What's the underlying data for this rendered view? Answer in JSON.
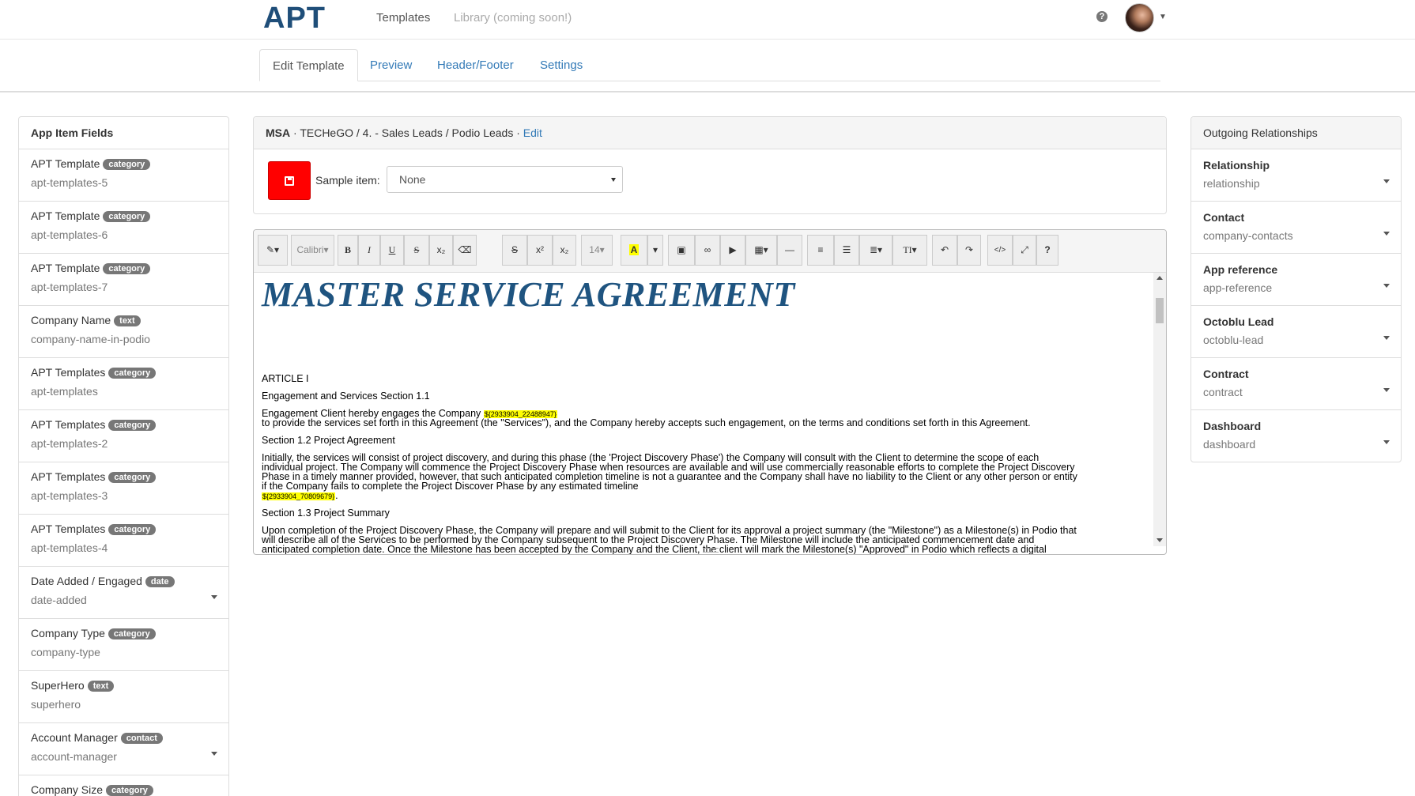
{
  "nav": {
    "logo": "APT",
    "templates": "Templates",
    "library": "Library (coming soon!)",
    "help_glyph": "?"
  },
  "tabs": [
    {
      "label": "Edit Template"
    },
    {
      "label": "Preview"
    },
    {
      "label": "Header/Footer"
    },
    {
      "label": "Settings"
    }
  ],
  "left_panel": {
    "title": "App Item Fields",
    "fields": [
      {
        "label": "APT Template",
        "type": "category",
        "slug": "apt-templates-5"
      },
      {
        "label": "APT Template",
        "type": "category",
        "slug": "apt-templates-6"
      },
      {
        "label": "APT Template",
        "type": "category",
        "slug": "apt-templates-7"
      },
      {
        "label": "Company Name",
        "type": "text",
        "slug": "company-name-in-podio"
      },
      {
        "label": "APT Templates",
        "type": "category",
        "slug": "apt-templates"
      },
      {
        "label": "APT Templates",
        "type": "category",
        "slug": "apt-templates-2"
      },
      {
        "label": "APT Templates",
        "type": "category",
        "slug": "apt-templates-3"
      },
      {
        "label": "APT Templates",
        "type": "category",
        "slug": "apt-templates-4"
      },
      {
        "label": "Date Added / Engaged",
        "type": "date",
        "slug": "date-added"
      },
      {
        "label": "Company Type",
        "type": "category",
        "slug": "company-type"
      },
      {
        "label": "SuperHero",
        "type": "text",
        "slug": "superhero"
      },
      {
        "label": "Account Manager",
        "type": "contact",
        "slug": "account-manager"
      },
      {
        "label": "Company Size",
        "type": "category",
        "slug": ""
      }
    ]
  },
  "center": {
    "crumb_bold": "MSA",
    "crumb_rest": " · TECHeGO / 4. - Sales Leads / Podio Leads · ",
    "crumb_edit": "Edit",
    "sample_label": "Sample item:",
    "sample_value": "None"
  },
  "toolbar": {
    "font": "Calibri",
    "size": "14",
    "bold": "B",
    "italic": "I",
    "underline": "U",
    "strike": "S",
    "sub": "x₂",
    "sup": "x²",
    "highlight": "A",
    "text_style": "TI"
  },
  "document": {
    "title": "MASTER SERVICE AGREEMENT",
    "article": "ARTICLE I",
    "section_1_1": "Engagement and Services Section 1.1",
    "engagement_pre": "Engagement Client hereby engages the Company ",
    "placeholder_1": "${2933904_22488947}",
    "engagement_line2": "to provide the services set forth in this Agreement (the \"Services\"), and the Company hereby accepts such engagement, on the terms and conditions set forth in this Agreement.",
    "section_1_2": "Section 1.2 Project Agreement",
    "p2_l1": "Initially, the services will consist of project discovery, and during this phase (the 'Project Discovery Phase') the Company will consult with the Client to determine the scope of each",
    "p2_l2": "individual project. The Company will commence the Project Discovery Phase when resources are available and will use commercially reasonable efforts to complete the Project Discovery",
    "p2_l3": "Phase in a timely manner provided, however, that such anticipated completion timeline is not a guarantee and the Company shall have no liability to the Client or any other person or entity",
    "p2_l4": "if the Company fails to complete the Project Discover Phase by any estimated timeline",
    "placeholder_2": "${2933904_70809679}",
    "section_1_3": "Section 1.3 Project Summary",
    "p3_l1": "Upon completion of the Project Discovery Phase, the Company will prepare and will submit to the Client for its approval a project summary (the \"Milestone\") as a Milestone(s) in Podio that",
    "p3_l2": "will describe all of the Services to be performed by the Company subsequent to the Project Discovery Phase. The Milestone will include the anticipated commencement date and",
    "p3_l3": "anticipated completion date. Once the Milestone has been accepted by the Company and the Client, the client will mark the Milestone(s) \"Approved\" in Podio which reflects a digital"
  },
  "right_panel": {
    "title": "Outgoing Relationships",
    "items": [
      {
        "label": "Relationship",
        "slug": "relationship"
      },
      {
        "label": "Contact",
        "slug": "company-contacts"
      },
      {
        "label": "App reference",
        "slug": "app-reference"
      },
      {
        "label": "Octoblu Lead",
        "slug": "octoblu-lead"
      },
      {
        "label": "Contract",
        "slug": "contract"
      },
      {
        "label": "Dashboard",
        "slug": "dashboard"
      }
    ]
  },
  "colors": {
    "brand": "#1f4e79",
    "link": "#337ab7",
    "save_button": "#ff0000",
    "highlight": "#ffff00",
    "doc_title": "#1f5480"
  }
}
